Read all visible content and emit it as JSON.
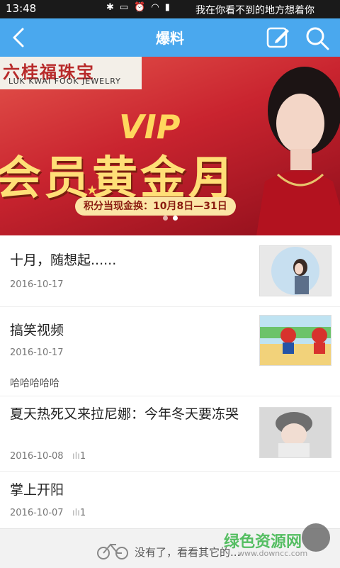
{
  "status_bar": {
    "time": "13:48",
    "ticker": "我在你看不到的地方想着你"
  },
  "header": {
    "title": "爆料"
  },
  "banner": {
    "brand_cn": "六桂福珠宝",
    "brand_en": "LUK KWAI FOOK JEWELRY",
    "vip": "VIP",
    "headline": "会员黄金月",
    "subline": "积分当现金换：10月8日—31日",
    "slide_count": 2,
    "active_slide": 2,
    "colors": {
      "primary": "#c9242f",
      "gold": "#ffd75e"
    }
  },
  "articles": [
    {
      "title": "十月，随想起......",
      "date": "2016-10-17",
      "thumb": "girl-portrait"
    },
    {
      "title": "搞笑视频",
      "date": "2016-10-17",
      "thumb": "toy-figures"
    },
    {
      "title": "夏天热死又来拉尼娜：今年冬天要冻哭",
      "date": "2016-10-08",
      "views": "1",
      "thumb": "winter-girl"
    },
    {
      "title": "掌上开阳",
      "date": "2016-10-07",
      "views": "1"
    }
  ],
  "tagline": "哈哈哈哈哈",
  "footer": {
    "message": "没有了，看看其它的...",
    "watermark": "绿色资源网",
    "watermark_url": "www.downcc.com"
  },
  "theme": {
    "accent": "#4aa8ee"
  }
}
